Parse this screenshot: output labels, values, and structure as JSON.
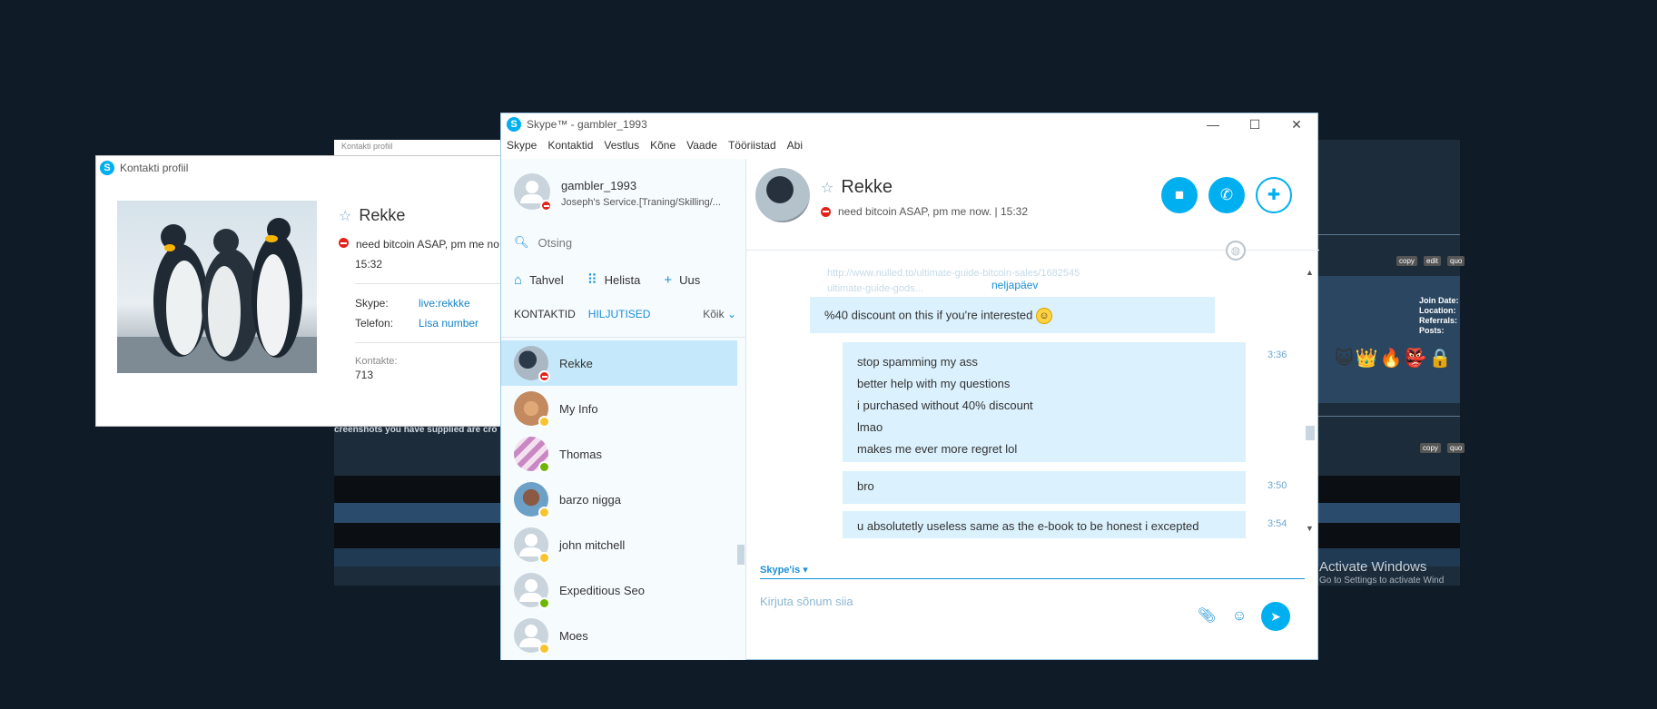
{
  "background": {
    "profile_title": "Kontakti profiil",
    "footnote": "creenshots you have supplied are cro",
    "member_fields": [
      "Join Date:",
      "Location:",
      "Referrals:",
      "Posts:"
    ],
    "btns": [
      "copy",
      "edit",
      "quo",
      "copy",
      "quo"
    ],
    "emojis": "😺👑🔥👺🔒",
    "activate_title": "Activate Windows",
    "activate_sub": "Go to Settings to activate Wind"
  },
  "profile": {
    "title": "Kontakti profiil",
    "name": "Rekke",
    "status": "need bitcoin ASAP, pm me no",
    "time": "15:32",
    "skype_label": "Skype:",
    "skype_value": "live:rekkke",
    "phone_label": "Telefon:",
    "phone_value": "Lisa number",
    "contacts_label": "Kontakte:",
    "contacts_value": "713"
  },
  "window": {
    "title": "Skype™ - gambler_1993",
    "controls": [
      "—",
      "☐",
      "✕"
    ]
  },
  "menu": [
    "Skype",
    "Kontaktid",
    "Vestlus",
    "Kõne",
    "Vaade",
    "Tööriistad",
    "Abi"
  ],
  "me": {
    "username": "gambler_1993",
    "mood": "Joseph's Service.[Traning/Skilling/..."
  },
  "search": {
    "placeholder": "Otsing"
  },
  "actions": [
    {
      "icon": "⌂",
      "label": "Tahvel"
    },
    {
      "icon": "⠿",
      "label": "Helista"
    },
    {
      "icon": "+",
      "label": "Uus"
    }
  ],
  "tabs": {
    "contacts": "KONTAKTID",
    "recent": "HILJUTISED",
    "all": "Kõik"
  },
  "contacts": [
    {
      "name": "Rekke",
      "status": "dnd"
    },
    {
      "name": "My Info",
      "status": "away"
    },
    {
      "name": "Thomas",
      "status": "online"
    },
    {
      "name": "barzo nigga",
      "status": "away"
    },
    {
      "name": "john mitchell",
      "status": "away"
    },
    {
      "name": "Expeditious Seo",
      "status": "online"
    },
    {
      "name": "Moes",
      "status": "away"
    }
  ],
  "chat": {
    "name": "Rekke",
    "status": "need bitcoin ASAP, pm me now. | 15:32",
    "faded_lines": [
      "http://www.nulled.to/ultimate-guide-bitcoin-sales/1682545",
      "ultimate-guide-gods..."
    ],
    "day_label": "neljapäev",
    "messages": [
      {
        "text": "%40 discount on this if you're interested",
        "time": ""
      },
      {
        "lines": [
          "stop spamming my ass",
          "better help with my questions",
          "i purchased without 40% discount",
          "lmao",
          "makes me ever more regret lol"
        ],
        "time": "3:36"
      },
      {
        "text": "bro",
        "time": "3:50"
      },
      {
        "text": "u absolutetly useless same as the e-book to be honest i excepted",
        "time": "3:54"
      }
    ],
    "compose_label": "Skype'is ▾",
    "compose_placeholder": "Kirjuta sõnum siia"
  }
}
